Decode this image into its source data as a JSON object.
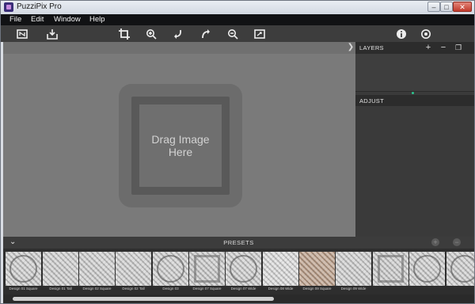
{
  "window": {
    "title": "PuzziPix Pro"
  },
  "menu": [
    "File",
    "Edit",
    "Window",
    "Help"
  ],
  "toolbar": {
    "left": [
      "fit-screen-icon",
      "save-icon"
    ],
    "center": [
      "crop-icon",
      "zoom-in-icon",
      "rotate-left-icon",
      "rotate-right-icon",
      "zoom-out-icon",
      "image-size-icon"
    ],
    "right": [
      "info-icon",
      "settings-icon"
    ]
  },
  "canvas": {
    "drop_text": "Drag Image Here"
  },
  "layers": {
    "title": "LAYERS",
    "add": "+",
    "remove": "−"
  },
  "adjust": {
    "title": "ADJUST"
  },
  "presets": {
    "title": "PRESETS",
    "items": [
      {
        "label": "Design 01 Square"
      },
      {
        "label": "Design 01 Tall"
      },
      {
        "label": "Design 02 Square"
      },
      {
        "label": "Design 02 Tall"
      },
      {
        "label": "Design 03"
      },
      {
        "label": "Design 07 Square"
      },
      {
        "label": "Design 07 Wide"
      },
      {
        "label": "Design 08 Wide"
      },
      {
        "label": "Design 09 Square"
      },
      {
        "label": "Design 09 Wide"
      },
      {
        "label": ""
      },
      {
        "label": ""
      },
      {
        "label": ""
      }
    ]
  },
  "colors": {
    "accent": "#2dc58f",
    "toolbar": "#3d3d3d",
    "canvas": "#7a7a7a"
  }
}
